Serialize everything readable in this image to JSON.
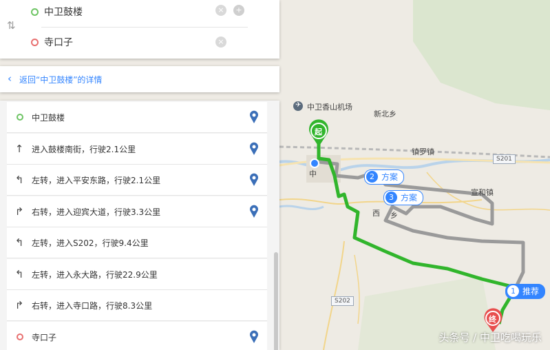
{
  "search": {
    "from": "中卫鼓楼",
    "to": "寺口子",
    "swap_icon": "⇅",
    "from_color": "#6dc463",
    "to_color": "#e86f6f"
  },
  "back_link": "返回“中卫鼓楼”的详情",
  "steps": [
    {
      "icon": "start-dot-icon",
      "text": "中卫鼓楼",
      "pin": true
    },
    {
      "icon": "arrow-up-icon",
      "glyph": "↑",
      "text": "进入鼓楼南街，行驶2.1公里",
      "pin": true
    },
    {
      "icon": "turn-left-icon",
      "glyph": "↰",
      "text": "左转，进入平安东路，行驶2.1公里",
      "pin": true
    },
    {
      "icon": "turn-right-icon",
      "glyph": "↱",
      "text": "右转，进入迎宾大道，行驶3.3公里",
      "pin": true
    },
    {
      "icon": "turn-left-icon",
      "glyph": "↰",
      "text": "左转，进入S202，行驶9.4公里",
      "pin": false
    },
    {
      "icon": "turn-left-icon",
      "glyph": "↰",
      "text": "左转，进入永大路，行驶22.9公里",
      "pin": false
    },
    {
      "icon": "turn-right-icon",
      "glyph": "↱",
      "text": "右转，进入寺口路，行驶8.3公里",
      "pin": false
    },
    {
      "icon": "end-dot-icon",
      "text": "寺口子",
      "pin": true
    }
  ],
  "map": {
    "labels": {
      "airport": "中卫香山机场",
      "xinbei": "新北乡",
      "zhenluo": "镇罗镇",
      "xuanhe": "宣和镇",
      "zhong": "中",
      "xi": "西",
      "xiang": "乡"
    },
    "roads": {
      "s201": "S201",
      "s202": "S202"
    },
    "markers": {
      "start": "起",
      "end": "终"
    },
    "route_badges": [
      {
        "num": "1",
        "text": "推荐",
        "recommended": true
      },
      {
        "num": "2",
        "text": "方案",
        "recommended": false
      },
      {
        "num": "3",
        "text": "方案",
        "recommended": false
      }
    ],
    "colors": {
      "recommended_route": "#31b52c",
      "alt_route": "#9a9a9a",
      "accent": "#3385ff"
    }
  },
  "watermark": "头条号 / 中卫吃喝玩乐"
}
